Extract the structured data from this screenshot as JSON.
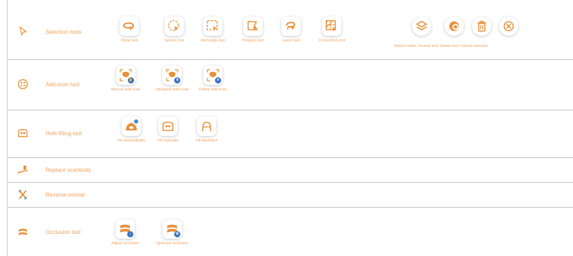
{
  "colors": {
    "accent": "#e8913c",
    "label": "#f0a05c",
    "badge": "#3e74c2",
    "divider": "#c3c3c3"
  },
  "rows": {
    "selection": {
      "label": "Selection tools",
      "icon": "cursor-arrow-icon",
      "tools": {
        "plane": "Plane tool",
        "sphere": "Sphere tool",
        "rectangle": "Rectangle tool",
        "polygon": "Polygon tool",
        "lasso": "Lasso tool",
        "connection": "Connection tool"
      },
      "group_label": "Select visible, Inverse tool, Delete tool, Cancel selection"
    },
    "addscan": {
      "label": "Add-scan tool",
      "icon": "add-scan-icon",
      "tools": {
        "manual": "Manual add-scan",
        "intelligent": "Intelligent add-scan",
        "delete": "Delete add-scan"
      },
      "badges": {
        "intelligent": "A"
      }
    },
    "holefill": {
      "label": "Hole filling tool",
      "icon": "hole-fill-icon",
      "tools": {
        "auto": "Fill automatically",
        "manual": "Fill manually",
        "abutment": "Fill abutment"
      }
    },
    "replace": {
      "label": "Replace scanbody",
      "icon": "scanbody-icon"
    },
    "reverse": {
      "label": "Reverse normal",
      "icon": "reverse-normal-icon"
    },
    "occlusion": {
      "label": "Occlusion tool",
      "icon": "occlusion-icon",
      "tools": {
        "adjust": "Adjust occlusion",
        "optimize": "Optimize occlusion"
      }
    }
  }
}
